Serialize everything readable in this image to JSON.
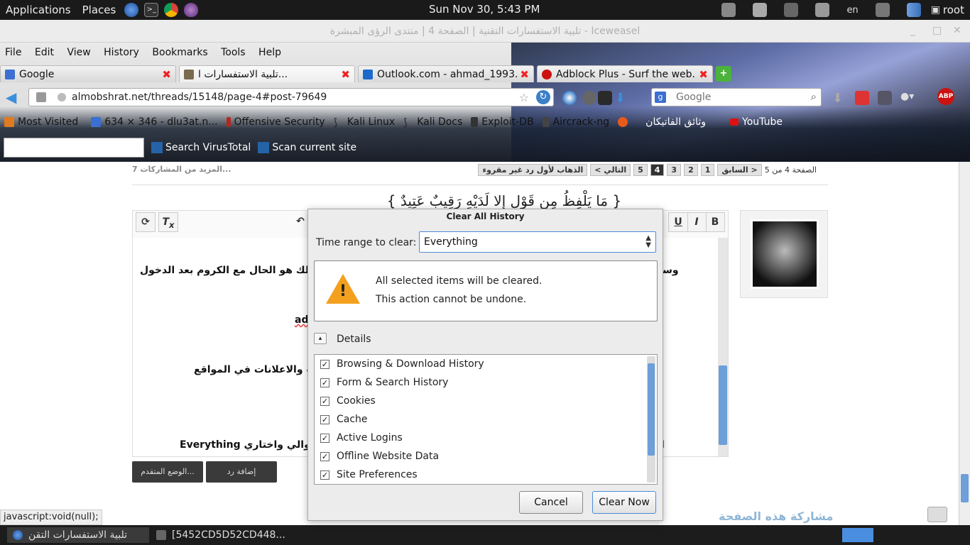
{
  "panel": {
    "applications": "Applications",
    "places": "Places",
    "clock": "Sun Nov 30,  5:43 PM",
    "lang": "en",
    "user": "root"
  },
  "window": {
    "title": "تلبية الاستفسارات التقنية | الصفحة 4 | منتدى الرؤى المبشرة - Iceweasel"
  },
  "menubar": [
    "File",
    "Edit",
    "View",
    "History",
    "Bookmarks",
    "Tools",
    "Help"
  ],
  "tabs": [
    {
      "label": "Google",
      "color": "#3b6fd1"
    },
    {
      "label": "تلبية الاستفسارات ا...",
      "color": "#7a6b4f"
    },
    {
      "label": "Outlook.com - ahmad_1993...",
      "color": "#1b6ac9"
    },
    {
      "label": "Adblock Plus - Surf the web...",
      "color": "#c11"
    }
  ],
  "navbar": {
    "url": "almobshrat.net/threads/15148/page-4#post-79649",
    "search_placeholder": "Google"
  },
  "bookmarks": [
    {
      "label": "Most Visited",
      "color": "#e07b20"
    },
    {
      "label": "634 × 346 - dlu3at.n...",
      "color": "#3b6fd1"
    },
    {
      "label": "Offensive Security",
      "color": "#b3281e"
    },
    {
      "label": "Kali Linux",
      "color": "#222"
    },
    {
      "label": "Kali Docs",
      "color": "#222"
    },
    {
      "label": "Exploit-DB",
      "color": "#333"
    },
    {
      "label": "Aircrack-ng",
      "color": "#444"
    },
    {
      "label": "",
      "color": "#e85a1a"
    },
    {
      "label": "وثائق الفاتيكان",
      "color": "#777"
    },
    {
      "label": "YouTube",
      "color": "#d11"
    }
  ],
  "vtbar": {
    "search_vt": "Search VirusTotal",
    "scan_site": "Scan current site"
  },
  "page": {
    "pager_label": "الصفحة 4 من 5",
    "prev": "< السابق",
    "pages": [
      "1",
      "2",
      "3",
      "4",
      "5"
    ],
    "current_page": "4",
    "next": "التالي >",
    "first_unread": "الذهاب لأول رد غير مقروء",
    "more_posts": "المزيد من المشاركات 7...",
    "ayah": "{ مَا يَلْفِظُ مِن قَوْلٍ إِلا لَدَيْهِ رَقِيبٌ عَتِيدٌ }",
    "editor_lines": [
      "وستجين",
      "لك هو الحال مع الكروم بعد الدخول",
      "adl",
      "ت والاعلانات في المواقع",
      "ا",
      "لتوالي واختاري Everything"
    ],
    "btn_reply": "إضافة رد",
    "btn_advanced": "الوضع المتقدم...",
    "share": "مشاركة هذه الصفحة",
    "status": "javascript:void(null);"
  },
  "taskbar": {
    "task1": "تلبية الاستفسارات التقن",
    "task2": "[5452CD5D52CD448..."
  },
  "dialog": {
    "title": "Clear All History",
    "time_range_label": "Time range to clear:",
    "time_range_value": "Everything",
    "warn1": "All selected items will be cleared.",
    "warn2": "This action cannot be undone.",
    "details": "Details",
    "items": [
      "Browsing & Download History",
      "Form & Search History",
      "Cookies",
      "Cache",
      "Active Logins",
      "Offline Website Data",
      "Site Preferences"
    ],
    "cancel": "Cancel",
    "clear_now": "Clear Now"
  }
}
